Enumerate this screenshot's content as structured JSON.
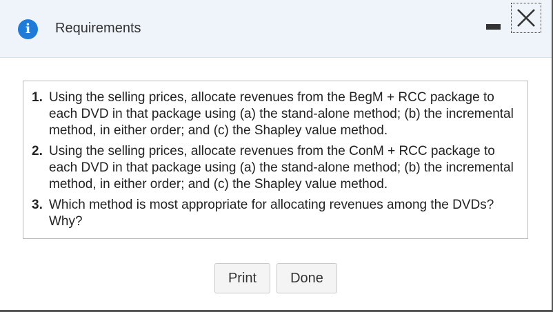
{
  "header": {
    "title": "Requirements",
    "info_icon_glyph": "i",
    "icons": [
      "info-icon",
      "minimize-icon",
      "close-icon"
    ]
  },
  "requirements": [
    {
      "number": "1.",
      "text": "Using the selling prices, allocate revenues from the BegM + RCC package to each DVD in that package using (a) the stand-alone method; (b) the incremental method, in either order; and (c) the Shapley value method."
    },
    {
      "number": "2.",
      "text": "Using the selling prices, allocate revenues from the ConM + RCC package to each DVD in that package using (a) the stand-alone method; (b) the incremental method, in either order; and (c) the Shapley value method."
    },
    {
      "number": "3.",
      "text": "Which method is most appropriate for allocating revenues among the DVDs? Why?"
    }
  ],
  "buttons": {
    "print_label": "Print",
    "done_label": "Done"
  },
  "colors": {
    "header_bg": "#eef4fa",
    "info_icon": "#1e7bd8",
    "button_bg": "#f4f4f4"
  }
}
